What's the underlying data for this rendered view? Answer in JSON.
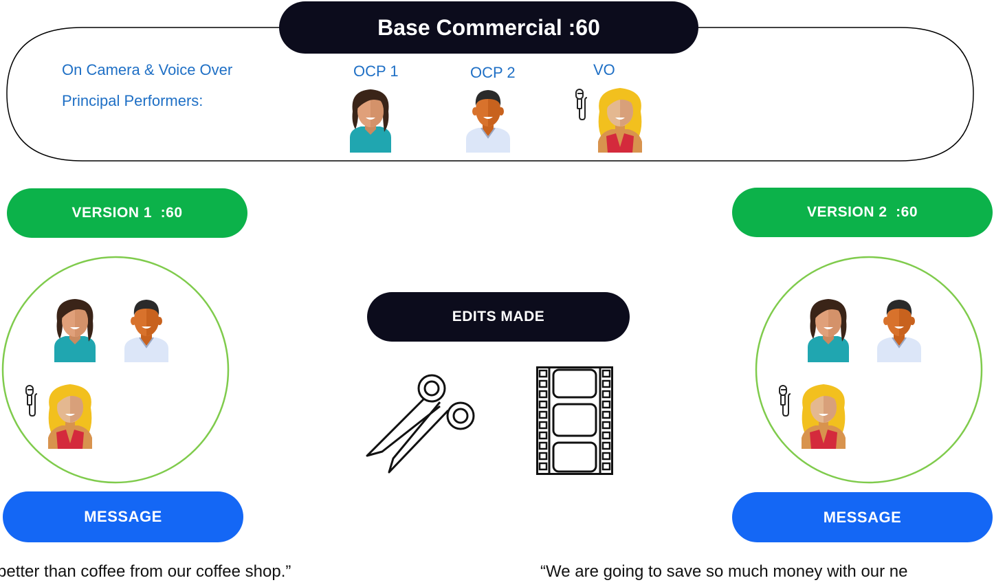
{
  "base": {
    "title": "Base Commercial :60",
    "line1": "On Camera & Voice Over",
    "line2": "Principal Performers:",
    "performers": [
      {
        "label": "OCP 1",
        "icon": "woman-avatar-icon"
      },
      {
        "label": "OCP 2",
        "icon": "man-avatar-icon"
      },
      {
        "label": "VO",
        "icon": "voiceover-woman-avatar-icon"
      }
    ]
  },
  "version1": {
    "label": "VERSION 1  :60",
    "message_label": "MESSAGE",
    "quote": "better than coffee from our coffee shop.”"
  },
  "version2": {
    "label": "VERSION 2  :60",
    "message_label": "MESSAGE",
    "quote": "“We are going to save so much money with our ne"
  },
  "edits": {
    "label": "EDITS MADE"
  },
  "colors": {
    "green": "#0cb24a",
    "blue": "#1467f5",
    "dark": "#0c0c1c",
    "text_blue": "#1e6fc5",
    "circle": "#7fcb4c"
  }
}
